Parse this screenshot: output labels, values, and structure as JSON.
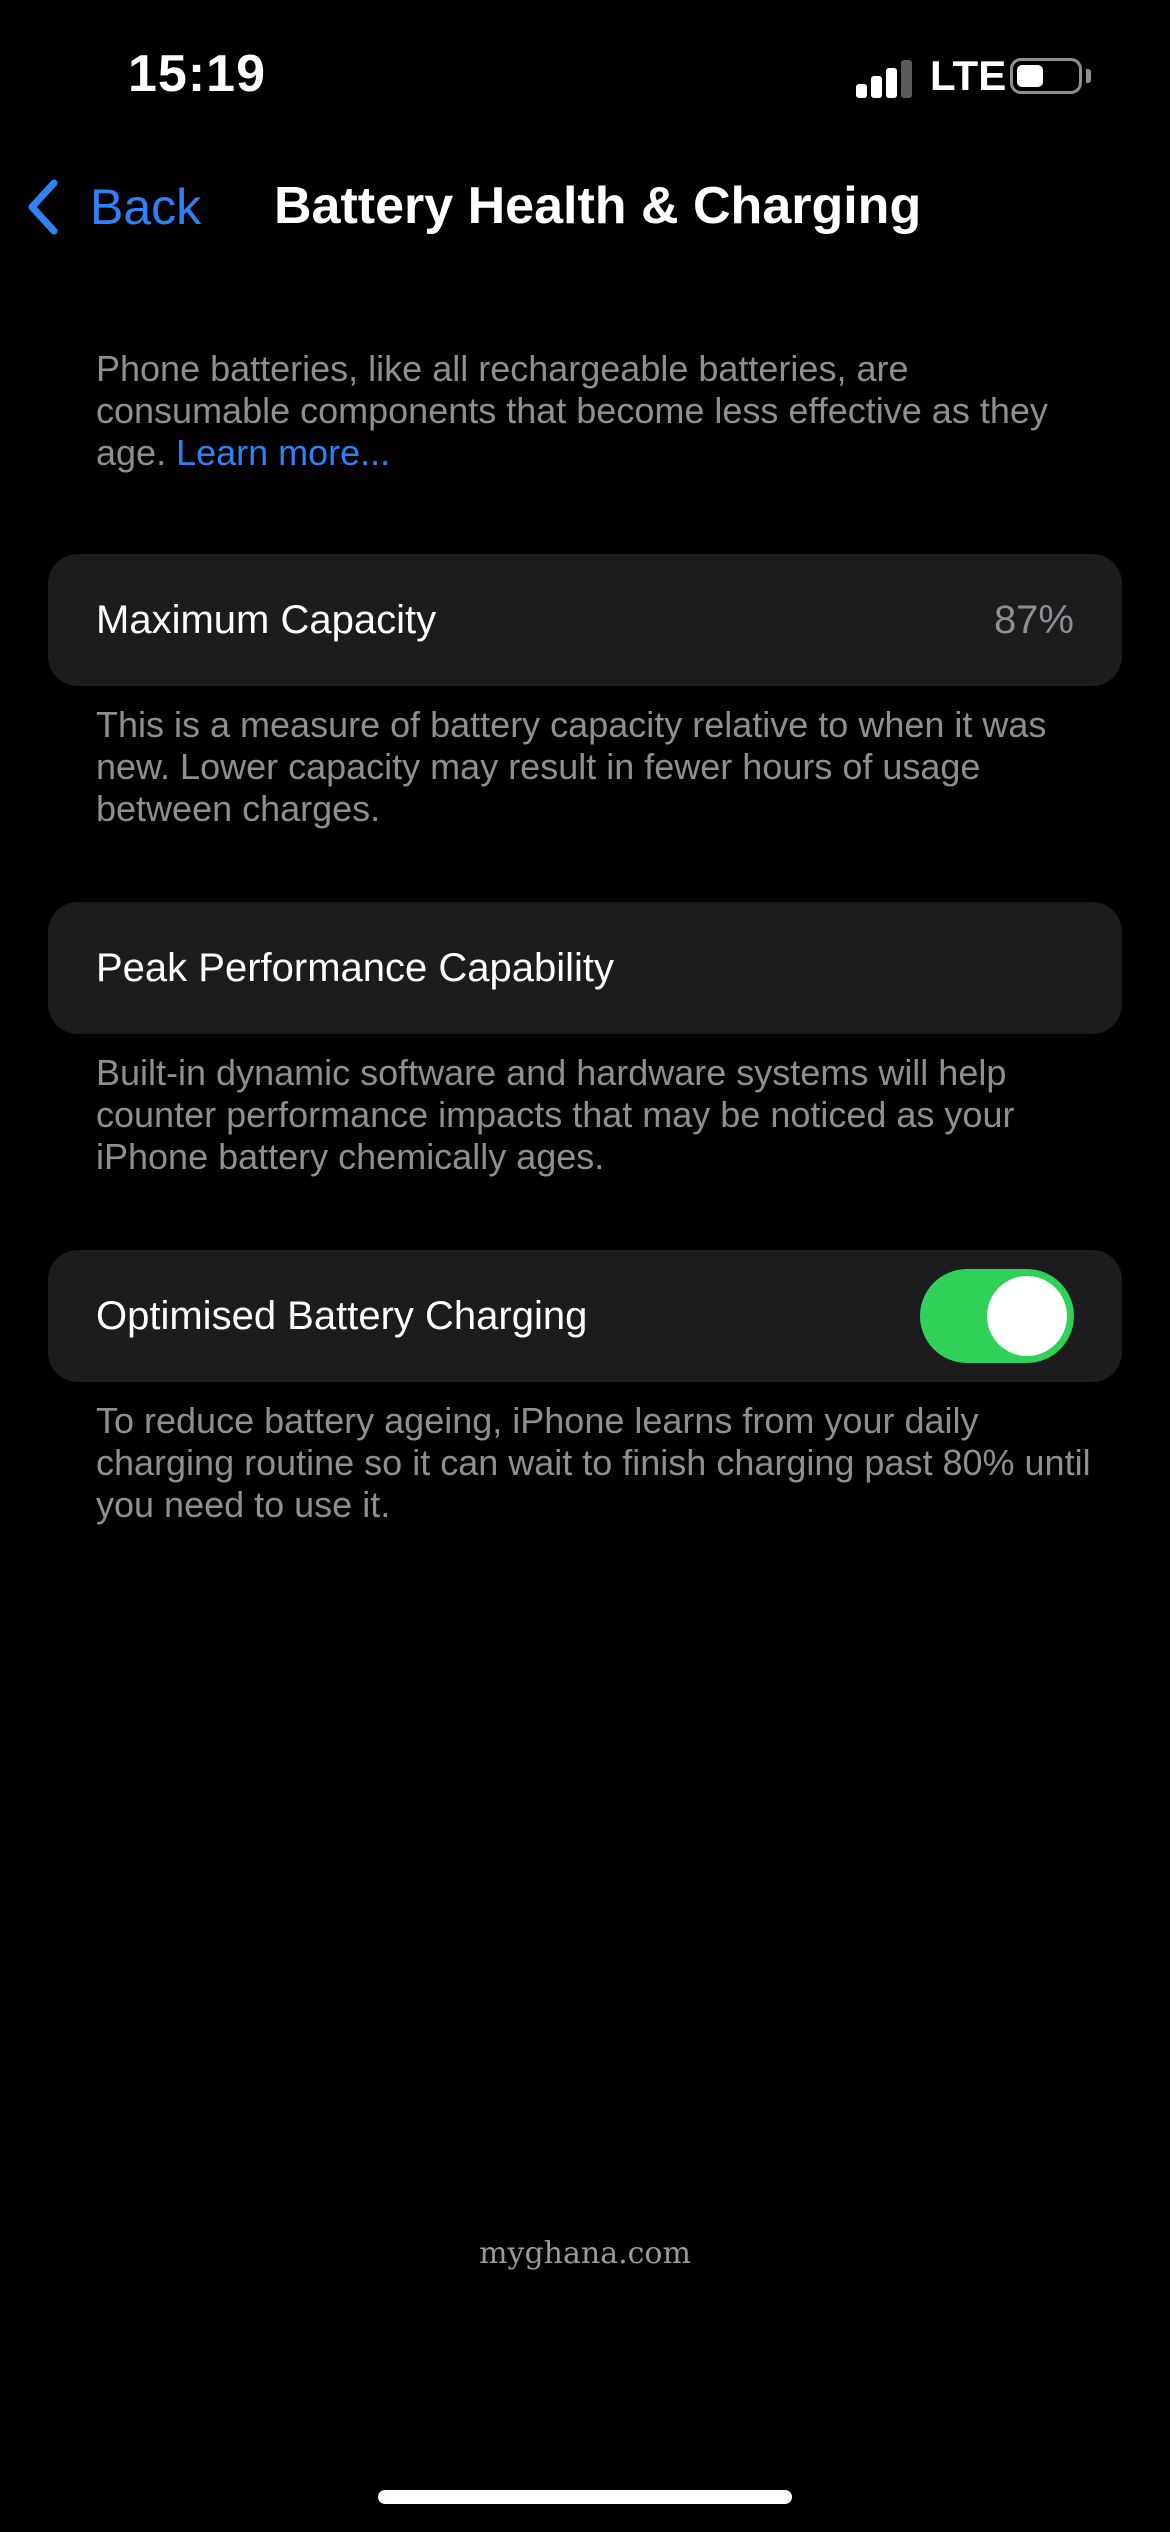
{
  "status_bar": {
    "time": "15:19",
    "network": "LTE",
    "signal_bars_active": 3,
    "signal_bars_total": 4,
    "battery_level_fraction": 0.45,
    "icons": [
      "signal-icon",
      "battery-icon"
    ]
  },
  "nav": {
    "back_label": "Back",
    "back_icon": "chevron-back-icon",
    "title": "Battery Health & Charging"
  },
  "intro": {
    "text": "Phone batteries, like all rechargeable batteries, are consumable components that become less effective as they age. ",
    "link": "Learn more..."
  },
  "maximum_capacity": {
    "label": "Maximum Capacity",
    "value": "87%",
    "footnote": "This is a measure of battery capacity relative to when it was new. Lower capacity may result in fewer hours of usage between charges."
  },
  "peak_performance": {
    "label": "Peak Performance Capability",
    "footnote": "Built-in dynamic software and hardware systems will help counter performance impacts that may be noticed as your iPhone battery chemically ages."
  },
  "optimised_charging": {
    "label": "Optimised Battery Charging",
    "enabled": true,
    "footnote": "To reduce battery ageing, iPhone learns from your daily charging routine so it can wait to finish charging past 80% until you need to use it."
  },
  "watermark": "myghana.com",
  "colors": {
    "background": "#000000",
    "cell_background": "#1c1c1e",
    "accent_blue": "#2f82f5",
    "toggle_on": "#30d158",
    "secondary_text": "#8e8e93"
  }
}
